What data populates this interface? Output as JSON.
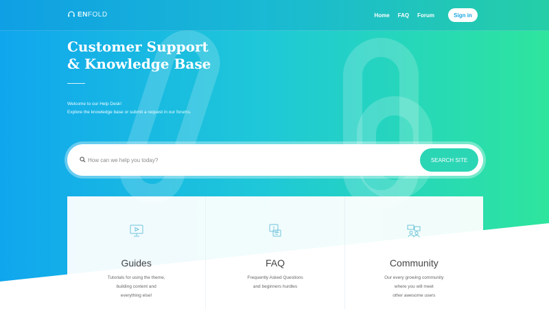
{
  "header": {
    "logo_text_strong": "EN",
    "logo_text_rest": "FOLD",
    "nav": [
      "Home",
      "FAQ",
      "Forum"
    ],
    "signin_label": "Sign in"
  },
  "hero": {
    "title_line1": "Customer Support",
    "title_line2": "& Knowledge Base",
    "subtitle_line1": "Welcome to our Help Desk!",
    "subtitle_line2": "Explore the knowledge base or submit a request in our forums."
  },
  "search": {
    "placeholder": "How can we help you today?",
    "button_label": "SEARCH SITE"
  },
  "cards": [
    {
      "title": "Guides",
      "desc": "Tutorials for using the theme,\nbuilding content and\neverything else!",
      "icon": "monitor-video-icon"
    },
    {
      "title": "FAQ",
      "desc": "Frequently Asked Questions\nand beginners hurdles",
      "icon": "question-chat-icon"
    },
    {
      "title": "Community",
      "desc": "Our every growing community\nwhere you will meet\nother awesome users",
      "icon": "people-network-icon"
    }
  ],
  "colors": {
    "gradient_start": "#10a6ee",
    "gradient_end": "#2ee59d",
    "search_button": "#2bd6b5",
    "icon_stroke": "#6fc3d9"
  }
}
